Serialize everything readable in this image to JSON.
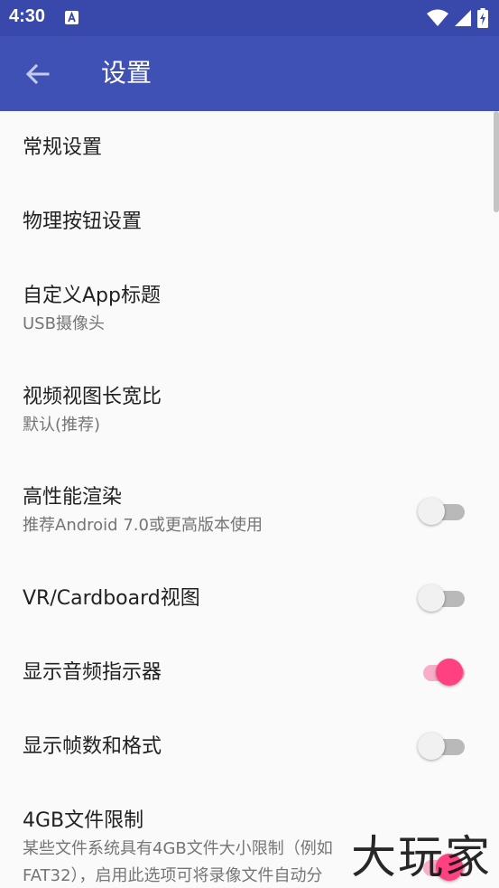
{
  "status_bar": {
    "time": "4:30"
  },
  "app_bar": {
    "title": "设置"
  },
  "settings": {
    "general": {
      "title": "常规设置"
    },
    "physical_buttons": {
      "title": "物理按钮设置"
    },
    "custom_title": {
      "title": "自定义App标题",
      "subtitle": "USB摄像头"
    },
    "aspect_ratio": {
      "title": "视频视图长宽比",
      "subtitle": "默认(推荐)"
    },
    "high_perf": {
      "title": "高性能渲染",
      "subtitle": "推荐Android 7.0或更高版本使用",
      "enabled": false
    },
    "vr_view": {
      "title": "VR/Cardboard视图",
      "enabled": false
    },
    "audio_indicator": {
      "title": "显示音频指示器",
      "enabled": true
    },
    "fps_format": {
      "title": "显示帧数和格式",
      "enabled": false
    },
    "file_limit": {
      "title": "4GB文件限制",
      "subtitle_line1": "某些文件系统具有4GB文件大小限制（例如",
      "subtitle_line2": "FAT32），启用此选项可将录像文件自动分",
      "enabled": true
    }
  },
  "watermark": "大玩家",
  "colors": {
    "status_bar": "#3949ab",
    "app_bar": "#3f51b5",
    "accent": "#ff4081"
  }
}
